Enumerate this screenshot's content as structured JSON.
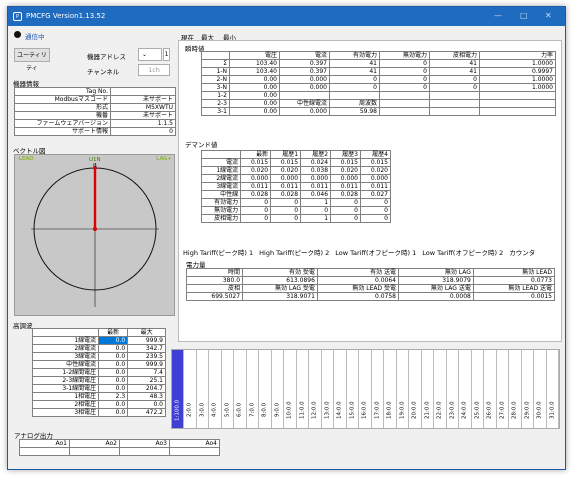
{
  "window": {
    "title": "PMCFG Version1.13.52",
    "icon": "app-icon"
  },
  "status": {
    "label": "通信中",
    "color": "#1a1a1a"
  },
  "utility_button": "ユーティリティ",
  "address": {
    "label": "機器アドレス",
    "value": "1"
  },
  "channel": {
    "label": "チャンネル",
    "value": "1ch"
  },
  "device_info": {
    "title": "機器情報",
    "rows": [
      [
        "Tag No.",
        ""
      ],
      [
        "Modbusマスコード",
        "未サポート"
      ],
      [
        "形式",
        "M5XWTU"
      ],
      [
        "機番",
        "未サポート"
      ],
      [
        "ファームウェアバージョン",
        "1.1.5"
      ],
      [
        "サポート情報",
        "0"
      ]
    ]
  },
  "vector": {
    "title": "ベクトル図",
    "lead_left": "-LEAD",
    "lead_right": "LAG+",
    "label": "U1N",
    "sublabel": "I1"
  },
  "tabs": [
    "現在",
    "最大",
    "最小"
  ],
  "measured": {
    "title": "瞬時値",
    "headers": [
      "",
      "電圧",
      "電流",
      "有効電力",
      "無効電力",
      "皮相電力",
      "力率"
    ],
    "rows": [
      [
        "Σ",
        "103.40",
        "0.397",
        "41",
        "0",
        "41",
        "1.0000"
      ],
      [
        "1-N",
        "103.40",
        "0.397",
        "41",
        "0",
        "41",
        "0.9997"
      ],
      [
        "2-N",
        "0.00",
        "0.000",
        "0",
        "0",
        "0",
        "1.0000"
      ],
      [
        "3-N",
        "0.00",
        "0.000",
        "0",
        "0",
        "0",
        "1.0000"
      ],
      [
        "1-2",
        "0.00",
        "",
        "",
        "",
        "",
        ""
      ],
      [
        "2-3",
        "0.00",
        "中性線電流",
        "周波数",
        "",
        "",
        ""
      ],
      [
        "3-1",
        "0.00",
        "0.000",
        "59.98",
        "",
        "",
        ""
      ]
    ]
  },
  "demand": {
    "title": "デマンド値",
    "headers": [
      "",
      "最新",
      "履歴1",
      "履歴2",
      "履歴3",
      "履歴4"
    ],
    "rows": [
      [
        "電流",
        "0.015",
        "0.015",
        "0.024",
        "0.015",
        "0.015"
      ],
      [
        "1線電流",
        "0.020",
        "0.020",
        "0.038",
        "0.020",
        "0.020"
      ],
      [
        "2線電流",
        "0.000",
        "0.000",
        "0.000",
        "0.000",
        "0.000"
      ],
      [
        "3線電流",
        "0.011",
        "0.011",
        "0.011",
        "0.011",
        "0.011"
      ],
      [
        "中性線",
        "0.028",
        "0.028",
        "0.046",
        "0.028",
        "0.027"
      ],
      [
        "有効電力",
        "0",
        "0",
        "1",
        "0",
        "0"
      ],
      [
        "無効電力",
        "0",
        "0",
        "0",
        "0",
        "0"
      ],
      [
        "皮相電力",
        "0",
        "0",
        "1",
        "0",
        "0"
      ]
    ]
  },
  "tariff_tabs": [
    "High Tariff(ピーク時) 1",
    "High Tariff(ピーク時) 2",
    "Low Tariff(オフピーク時) 1",
    "Low Tariff(オフピーク時) 2",
    "カウンタ"
  ],
  "energy": {
    "title": "電力量",
    "rows": [
      [
        "時間",
        "有効 受電",
        "有効 送電",
        "無効 LAG",
        "無効 LEAD"
      ],
      [
        "380.0",
        "613.0896",
        "0.0064",
        "318.9079",
        "0.0773"
      ],
      [
        "皮相",
        "無効 LAG 受電",
        "無効 LEAD 受電",
        "無効 LAG 送電",
        "無効 LEAD 送電"
      ],
      [
        "699.5027",
        "318.9071",
        "0.0758",
        "0.0008",
        "0.0015"
      ]
    ]
  },
  "harmonics": {
    "title": "高調波",
    "headers": [
      "",
      "最新",
      "最大"
    ],
    "rows": [
      [
        "1線電流",
        "0.0",
        "999.9"
      ],
      [
        "2線電流",
        "0.0",
        "342.7"
      ],
      [
        "3線電流",
        "0.0",
        "239.5"
      ],
      [
        "中性線電流",
        "0.0",
        "999.9"
      ],
      [
        "1-2線間電圧",
        "0.0",
        "7.4"
      ],
      [
        "2-3線間電圧",
        "0.0",
        "25.1"
      ],
      [
        "3-1線間電圧",
        "0.0",
        "204.7"
      ],
      [
        "1相電圧",
        "2.3",
        "48.3"
      ],
      [
        "2相電圧",
        "0.0",
        "0.0"
      ],
      [
        "3相電圧",
        "0.0",
        "472.2"
      ]
    ],
    "bars": [
      "1:100.0",
      "2:0.0",
      "3:0.0",
      "4:0.0",
      "5:0.0",
      "6:0.0",
      "7:0.0",
      "8:0.0",
      "9:0.0",
      "10:0.0",
      "11:0.0",
      "12:0.0",
      "13:0.0",
      "14:0.0",
      "15:0.0",
      "16:0.0",
      "17:0.0",
      "18:0.0",
      "19:0.0",
      "20:0.0",
      "21:0.0",
      "22:0.0",
      "23:0.0",
      "24:0.0",
      "25:0.0",
      "26:0.0",
      "27:0.0",
      "28:0.0",
      "29:0.0",
      "30:0.0",
      "31:0.0"
    ]
  },
  "analog": {
    "title": "アナログ出力",
    "headers": [
      "Ao1",
      "Ao2",
      "Ao3",
      "Ao4"
    ]
  }
}
